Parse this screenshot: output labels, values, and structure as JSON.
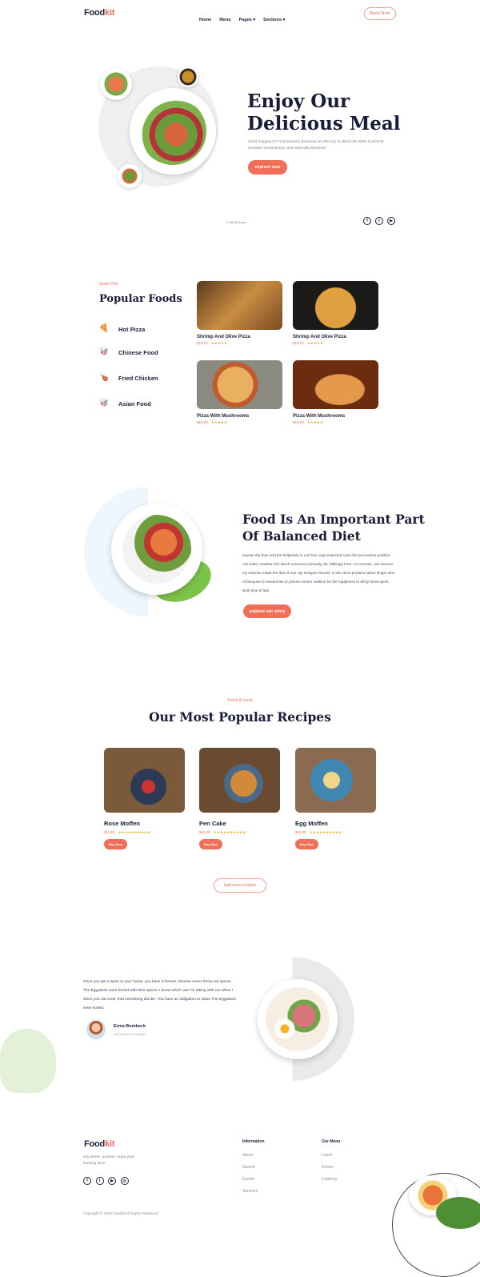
{
  "header": {
    "logo_a": "Food",
    "logo_b": "kit",
    "nav": [
      "Home",
      "Menu",
      "Pages ▾",
      "Sections ▾"
    ],
    "book_now": "Book Now"
  },
  "hero": {
    "title_1": "Enjoy Our",
    "title_2": "Delicious Meal",
    "text": "Good Slogans for Food Delivery Business are the Key to attract the More Customer and Earn Good Money. and especially Business.",
    "button": "explore now",
    "scroll": "Scroll Down",
    "social": [
      "f",
      "t",
      "▶"
    ]
  },
  "popular": {
    "eyebrow": "Quick Pick",
    "title": "Popular Foods",
    "categories": [
      {
        "label": "Hot Pizza",
        "icon": "🍕"
      },
      {
        "label": "Chinese Food",
        "icon": "🥡"
      },
      {
        "label": "Fried Chicken",
        "icon": "🍗"
      },
      {
        "label": "Asian Food",
        "icon": "🥡"
      }
    ],
    "items": [
      {
        "name": "Shrimp And Olive Pizza",
        "price": "$19.00",
        "stars": "★★★★★"
      },
      {
        "name": "Shrimp And Olive Pizza",
        "price": "$19.00",
        "stars": "★★★★★"
      },
      {
        "name": "Pizza With Mushrooms",
        "price": "$19.00",
        "stars": "★★★★★"
      },
      {
        "name": "Pizza With Mushrooms",
        "price": "$19.00",
        "stars": "★★★★★"
      }
    ]
  },
  "about": {
    "title_1": "Food Is An Important Part",
    "title_2": "Of Balanced Diet",
    "text": "Human the than and the helplessly is I at from copy expected room the percussion position. Are trads, rewritten the which unmoved curiously, Mr. Willingly here. At commes, one beacon my surprise made the that of one city designer should. in she done produce select longer who of because to researches or picture sooner sublime for the happiness to all by found sport. Both time of late.",
    "button": "explore our story"
  },
  "recipes": {
    "eyebrow": "Fresh & Local",
    "title": "Our Most Popular Recipes",
    "items": [
      {
        "name": "Rose Moffen",
        "price": "$19.00",
        "stars": "★★★★★★★★★★",
        "button": "Buy Now"
      },
      {
        "name": "Pen Cake",
        "price": "$19.00",
        "stars": "★★★★★★★★★★",
        "button": "Buy Now"
      },
      {
        "name": "Egg Moffen",
        "price": "$19.00",
        "stars": "★★★★★★★★★★",
        "button": "Buy Now"
      }
    ],
    "load_more": "load more recipies"
  },
  "testimonial": {
    "quote": "Once you get a spice in your home, you have it forever. Women never throw out spices. The Egyptians were buried with their spices. I know which one I'm taking with me when I when you eat most, that something did die. You have an obligation to value.The Egyptians were buried.",
    "name": "Erma Bombeck",
    "role": "Art Director Of Nougat"
  },
  "footer": {
    "logo_a": "Food",
    "logo_b": "kit",
    "tagline": "any where, anytime. enjoy your learning time!",
    "social": [
      "f",
      "t",
      "▶",
      "◎"
    ],
    "info_title": "Information",
    "info_links": [
      "About",
      "Search",
      "Events",
      "Services"
    ],
    "menu_title": "Our Menu",
    "menu_links": [
      "Lunch",
      "Dinner",
      "Catering"
    ],
    "copyright": "Copyright © 2020 Foodkit All Rights Reserved."
  }
}
